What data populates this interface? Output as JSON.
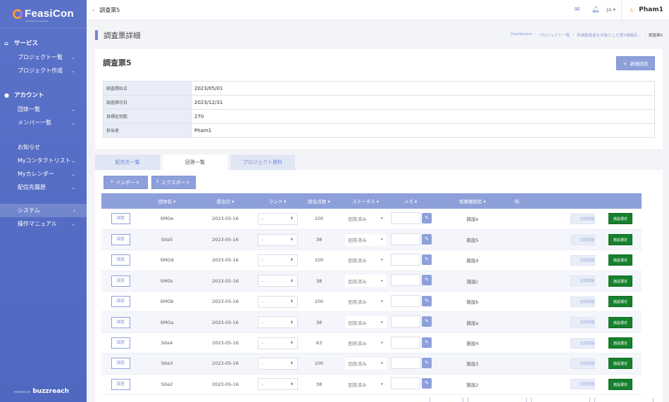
{
  "sidebar": {
    "logo": "FeasiCon",
    "logo_sub": "Feasibility Consensus",
    "sections": [
      {
        "head": "サービス",
        "items": [
          "プロジェクト一覧",
          "プロジェクト作成"
        ]
      },
      {
        "head": "アカウント",
        "items": [
          "団体一覧",
          "メンバー一覧"
        ]
      }
    ],
    "plain_items": [
      "お知らせ",
      "Myコンタクトリスト",
      "Myカレンダー",
      "配信先履歴",
      "システム",
      "操作マニュアル"
    ],
    "footer_small": "POWERED BY",
    "footer_brand": "buzzreach"
  },
  "topbar": {
    "back": "‹",
    "title": "調査票5",
    "lang": "JA",
    "user": "Pham1"
  },
  "page": {
    "title": "調査票詳細",
    "breadcrumbs": [
      "Dashboard",
      "プロジェクト一覧",
      "肝細胞患者を対象とした第3相臨床…",
      "調査票5"
    ]
  },
  "card": {
    "title": "調査票5",
    "new_button": "新規回答",
    "info": [
      {
        "label": "調査開始日",
        "value": "2023/05/01"
      },
      {
        "label": "調査締切日",
        "value": "2023/12/31"
      },
      {
        "label": "目標症例数",
        "value": "270"
      },
      {
        "label": "担当者",
        "value": "Pham1"
      }
    ]
  },
  "tabs": [
    "配信先一覧",
    "回答一覧",
    "プロジェクト資料"
  ],
  "toolbar": {
    "import": "インポート",
    "export": "エクスポート"
  },
  "table": {
    "headers": [
      "",
      "団体名",
      "提出日",
      "ランク",
      "総合点数",
      "ステータス",
      "メモ",
      "医療機関名",
      "所",
      ""
    ],
    "answer_label": "回答",
    "light_label": "訪問調整",
    "green_label": "施設選定",
    "rows": [
      {
        "org": "SMOe",
        "date": "2023-05-16",
        "rank": "-",
        "score": "100",
        "status": "回答済み",
        "facility": "施設e"
      },
      {
        "org": "Site5",
        "date": "2023-05-16",
        "rank": "-",
        "score": "38",
        "status": "回答済み",
        "facility": "施設5"
      },
      {
        "org": "SMOd",
        "date": "2023-05-16",
        "rank": "-",
        "score": "100",
        "status": "回答済み",
        "facility": "施設d"
      },
      {
        "org": "SMOc",
        "date": "2023-05-16",
        "rank": "-",
        "score": "38",
        "status": "回答済み",
        "facility": "施設c"
      },
      {
        "org": "SMOb",
        "date": "2023-05-16",
        "rank": "-",
        "score": "100",
        "status": "回答済み",
        "facility": "施設b"
      },
      {
        "org": "SMOa",
        "date": "2023-05-16",
        "rank": "-",
        "score": "38",
        "status": "回答済み",
        "facility": "施設a"
      },
      {
        "org": "Site4",
        "date": "2023-05-16",
        "rank": "-",
        "score": "63",
        "status": "回答済み",
        "facility": "施設4"
      },
      {
        "org": "Site3",
        "date": "2023-05-16",
        "rank": "-",
        "score": "100",
        "status": "回答済み",
        "facility": "施設3"
      },
      {
        "org": "Site2",
        "date": "2023-05-16",
        "rank": "-",
        "score": "38",
        "status": "回答済み",
        "facility": "施設2"
      }
    ]
  },
  "colors": {
    "sidebar": "#5a72c8",
    "accent": "#8ea0da",
    "green": "#17812d"
  }
}
